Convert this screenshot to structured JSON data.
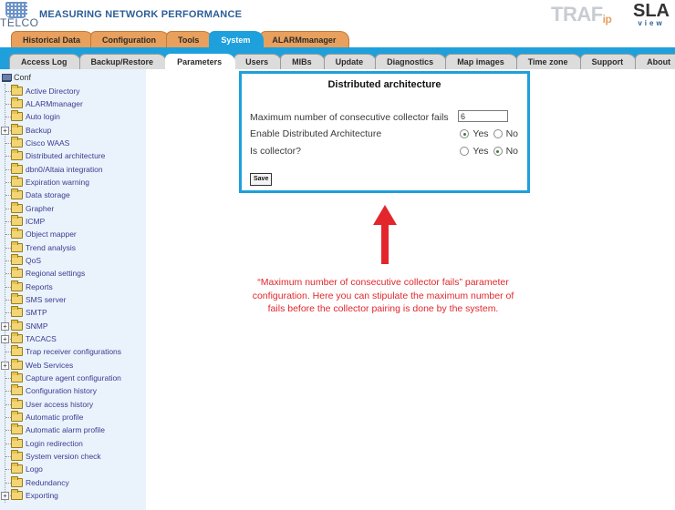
{
  "header": {
    "logo_text": "TELCO",
    "app_title": "MEASURING NETWORK PERFORMANCE",
    "brand_traf": "TRAF",
    "brand_traf_sub": "ip",
    "brand_sla": "SLA",
    "brand_sla_sub": "view"
  },
  "main_tabs": [
    {
      "label": "Historical Data",
      "active": false
    },
    {
      "label": "Configuration",
      "active": false
    },
    {
      "label": "Tools",
      "active": false
    },
    {
      "label": "System",
      "active": true
    },
    {
      "label": "ALARMmanager",
      "active": false
    }
  ],
  "sub_tabs": [
    {
      "label": "Access Log",
      "active": false
    },
    {
      "label": "Backup/Restore",
      "active": false
    },
    {
      "label": "Parameters",
      "active": true
    },
    {
      "label": "Users",
      "active": false
    },
    {
      "label": "MIBs",
      "active": false
    },
    {
      "label": "Update",
      "active": false
    },
    {
      "label": "Diagnostics",
      "active": false
    },
    {
      "label": "Map images",
      "active": false
    },
    {
      "label": "Time zone",
      "active": false
    },
    {
      "label": "Support",
      "active": false
    },
    {
      "label": "About",
      "active": false
    }
  ],
  "sidebar": {
    "root_label": "Conf",
    "items": [
      {
        "label": "Active Directory",
        "expandable": false
      },
      {
        "label": "ALARMmanager",
        "expandable": false
      },
      {
        "label": "Auto login",
        "expandable": false
      },
      {
        "label": "Backup",
        "expandable": true
      },
      {
        "label": "Cisco WAAS",
        "expandable": false
      },
      {
        "label": "Distributed architecture",
        "expandable": false
      },
      {
        "label": "dbn0/Altaia integration",
        "expandable": false
      },
      {
        "label": "Expiration warning",
        "expandable": false
      },
      {
        "label": "Data storage",
        "expandable": false
      },
      {
        "label": "Grapher",
        "expandable": false
      },
      {
        "label": "ICMP",
        "expandable": false
      },
      {
        "label": "Object mapper",
        "expandable": false
      },
      {
        "label": "Trend analysis",
        "expandable": false
      },
      {
        "label": "QoS",
        "expandable": false
      },
      {
        "label": "Regional settings",
        "expandable": false
      },
      {
        "label": "Reports",
        "expandable": false
      },
      {
        "label": "SMS server",
        "expandable": false
      },
      {
        "label": "SMTP",
        "expandable": false
      },
      {
        "label": "SNMP",
        "expandable": true
      },
      {
        "label": "TACACS",
        "expandable": true
      },
      {
        "label": "Trap receiver configurations",
        "expandable": false
      },
      {
        "label": "Web Services",
        "expandable": true
      },
      {
        "label": "Capture agent configuration",
        "expandable": false
      },
      {
        "label": "Configuration history",
        "expandable": false
      },
      {
        "label": "User access history",
        "expandable": false
      },
      {
        "label": "Automatic profile",
        "expandable": false
      },
      {
        "label": "Automatic alarm profile",
        "expandable": false
      },
      {
        "label": "Login redirection",
        "expandable": false
      },
      {
        "label": "System version check",
        "expandable": false
      },
      {
        "label": "Logo",
        "expandable": false
      },
      {
        "label": "Redundancy",
        "expandable": false
      },
      {
        "label": "Exporting",
        "expandable": true
      }
    ]
  },
  "panel": {
    "title": "Distributed architecture",
    "max_fails_label": "Maximum number of consecutive collector fails",
    "max_fails_value": "6",
    "enable_label": "Enable Distributed Architecture",
    "enable_value": "Yes",
    "is_collector_label": "Is collector?",
    "is_collector_value": "No",
    "yes_label": "Yes",
    "no_label": "No",
    "save_label": "Save"
  },
  "annotation": {
    "text": "“Maximum number of consecutive collector fails” parameter configuration. Here you can stipulate the maximum number of fails before the collector pairing is done by the system.",
    "color": "#e2262b"
  },
  "colors": {
    "accent_blue": "#1ea0dc",
    "main_tab_orange": "#e8a05c",
    "sub_tab_gray": "#dcdcdc",
    "sidebar_bg": "#eaf3fc",
    "tree_text": "#3b3b8f"
  }
}
